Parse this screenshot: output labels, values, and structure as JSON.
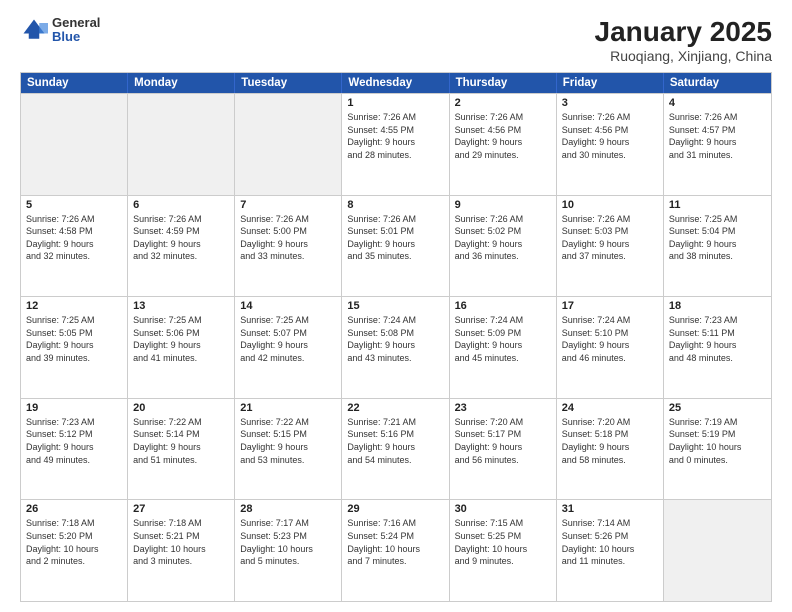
{
  "header": {
    "logo_general": "General",
    "logo_blue": "Blue",
    "month_year": "January 2025",
    "location": "Ruoqiang, Xinjiang, China"
  },
  "weekdays": [
    "Sunday",
    "Monday",
    "Tuesday",
    "Wednesday",
    "Thursday",
    "Friday",
    "Saturday"
  ],
  "rows": [
    [
      {
        "day": "",
        "info": ""
      },
      {
        "day": "",
        "info": ""
      },
      {
        "day": "",
        "info": ""
      },
      {
        "day": "1",
        "info": "Sunrise: 7:26 AM\nSunset: 4:55 PM\nDaylight: 9 hours\nand 28 minutes."
      },
      {
        "day": "2",
        "info": "Sunrise: 7:26 AM\nSunset: 4:56 PM\nDaylight: 9 hours\nand 29 minutes."
      },
      {
        "day": "3",
        "info": "Sunrise: 7:26 AM\nSunset: 4:56 PM\nDaylight: 9 hours\nand 30 minutes."
      },
      {
        "day": "4",
        "info": "Sunrise: 7:26 AM\nSunset: 4:57 PM\nDaylight: 9 hours\nand 31 minutes."
      }
    ],
    [
      {
        "day": "5",
        "info": "Sunrise: 7:26 AM\nSunset: 4:58 PM\nDaylight: 9 hours\nand 32 minutes."
      },
      {
        "day": "6",
        "info": "Sunrise: 7:26 AM\nSunset: 4:59 PM\nDaylight: 9 hours\nand 32 minutes."
      },
      {
        "day": "7",
        "info": "Sunrise: 7:26 AM\nSunset: 5:00 PM\nDaylight: 9 hours\nand 33 minutes."
      },
      {
        "day": "8",
        "info": "Sunrise: 7:26 AM\nSunset: 5:01 PM\nDaylight: 9 hours\nand 35 minutes."
      },
      {
        "day": "9",
        "info": "Sunrise: 7:26 AM\nSunset: 5:02 PM\nDaylight: 9 hours\nand 36 minutes."
      },
      {
        "day": "10",
        "info": "Sunrise: 7:26 AM\nSunset: 5:03 PM\nDaylight: 9 hours\nand 37 minutes."
      },
      {
        "day": "11",
        "info": "Sunrise: 7:25 AM\nSunset: 5:04 PM\nDaylight: 9 hours\nand 38 minutes."
      }
    ],
    [
      {
        "day": "12",
        "info": "Sunrise: 7:25 AM\nSunset: 5:05 PM\nDaylight: 9 hours\nand 39 minutes."
      },
      {
        "day": "13",
        "info": "Sunrise: 7:25 AM\nSunset: 5:06 PM\nDaylight: 9 hours\nand 41 minutes."
      },
      {
        "day": "14",
        "info": "Sunrise: 7:25 AM\nSunset: 5:07 PM\nDaylight: 9 hours\nand 42 minutes."
      },
      {
        "day": "15",
        "info": "Sunrise: 7:24 AM\nSunset: 5:08 PM\nDaylight: 9 hours\nand 43 minutes."
      },
      {
        "day": "16",
        "info": "Sunrise: 7:24 AM\nSunset: 5:09 PM\nDaylight: 9 hours\nand 45 minutes."
      },
      {
        "day": "17",
        "info": "Sunrise: 7:24 AM\nSunset: 5:10 PM\nDaylight: 9 hours\nand 46 minutes."
      },
      {
        "day": "18",
        "info": "Sunrise: 7:23 AM\nSunset: 5:11 PM\nDaylight: 9 hours\nand 48 minutes."
      }
    ],
    [
      {
        "day": "19",
        "info": "Sunrise: 7:23 AM\nSunset: 5:12 PM\nDaylight: 9 hours\nand 49 minutes."
      },
      {
        "day": "20",
        "info": "Sunrise: 7:22 AM\nSunset: 5:14 PM\nDaylight: 9 hours\nand 51 minutes."
      },
      {
        "day": "21",
        "info": "Sunrise: 7:22 AM\nSunset: 5:15 PM\nDaylight: 9 hours\nand 53 minutes."
      },
      {
        "day": "22",
        "info": "Sunrise: 7:21 AM\nSunset: 5:16 PM\nDaylight: 9 hours\nand 54 minutes."
      },
      {
        "day": "23",
        "info": "Sunrise: 7:20 AM\nSunset: 5:17 PM\nDaylight: 9 hours\nand 56 minutes."
      },
      {
        "day": "24",
        "info": "Sunrise: 7:20 AM\nSunset: 5:18 PM\nDaylight: 9 hours\nand 58 minutes."
      },
      {
        "day": "25",
        "info": "Sunrise: 7:19 AM\nSunset: 5:19 PM\nDaylight: 10 hours\nand 0 minutes."
      }
    ],
    [
      {
        "day": "26",
        "info": "Sunrise: 7:18 AM\nSunset: 5:20 PM\nDaylight: 10 hours\nand 2 minutes."
      },
      {
        "day": "27",
        "info": "Sunrise: 7:18 AM\nSunset: 5:21 PM\nDaylight: 10 hours\nand 3 minutes."
      },
      {
        "day": "28",
        "info": "Sunrise: 7:17 AM\nSunset: 5:23 PM\nDaylight: 10 hours\nand 5 minutes."
      },
      {
        "day": "29",
        "info": "Sunrise: 7:16 AM\nSunset: 5:24 PM\nDaylight: 10 hours\nand 7 minutes."
      },
      {
        "day": "30",
        "info": "Sunrise: 7:15 AM\nSunset: 5:25 PM\nDaylight: 10 hours\nand 9 minutes."
      },
      {
        "day": "31",
        "info": "Sunrise: 7:14 AM\nSunset: 5:26 PM\nDaylight: 10 hours\nand 11 minutes."
      },
      {
        "day": "",
        "info": ""
      }
    ]
  ]
}
